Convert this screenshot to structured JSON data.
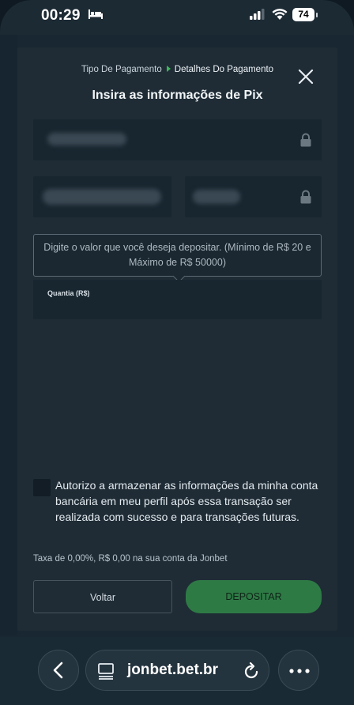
{
  "status_bar": {
    "time": "00:29",
    "battery": "74"
  },
  "modal": {
    "breadcrumb_step1": "Tipo De Pagamento",
    "breadcrumb_step2": "Detalhes Do Pagamento",
    "title": "Insira as informações de Pix",
    "tooltip": "Digite o valor que você deseja depositar. (Mínimo de R$ 20 e Máximo de R$ 50000)",
    "amount_label": "Quantia (R$)",
    "consent_text": "Autorizo a armazenar as informações da minha conta bancária em meu perfil após essa transação ser realizada com sucesso e para transações futuras.",
    "fee_text": "Taxa de 0,00%, R$ 0,00 na sua conta da Jonbet",
    "back_label": "Voltar",
    "deposit_label": "DEPOSITAR"
  },
  "browser": {
    "url": "jonbet.bet.br"
  },
  "colors": {
    "accent": "#3fb65a",
    "deposit_button": "#2e7a45"
  }
}
